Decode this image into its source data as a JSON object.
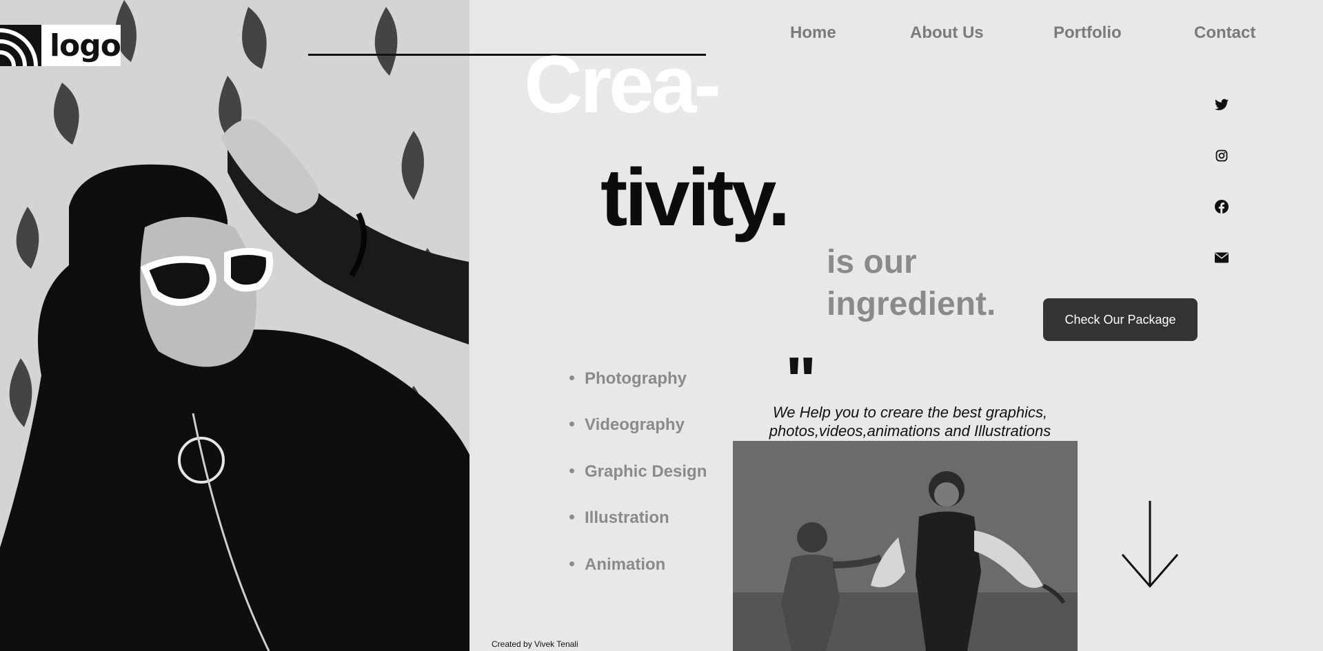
{
  "header": {
    "logo_text": "logo",
    "nav": [
      "Home",
      "About Us",
      "Portfolio",
      "Contact"
    ]
  },
  "hero": {
    "line_one": "Crea-",
    "line_two": "tivity.",
    "tagline_one": "is our",
    "tagline_two": "ingredient.",
    "cta_label": "Check Our Package"
  },
  "social_icons": [
    "twitter-icon",
    "instagram-icon",
    "facebook-icon",
    "mail-icon"
  ],
  "services": [
    "Photography",
    "Videography",
    "Graphic Design",
    "Illustration",
    "Animation"
  ],
  "quote": {
    "mark": "\"",
    "line_one": "We Help you to creare the best graphics,",
    "line_two": "photos,videos,animations and Illustrations"
  },
  "footer": {
    "credit": "Created by Vivek Tenali"
  },
  "colors": {
    "background": "#e8e8e8",
    "accent_dark": "#333333",
    "muted_text": "#8a8a8a",
    "nav_text": "#7a7a7a"
  }
}
